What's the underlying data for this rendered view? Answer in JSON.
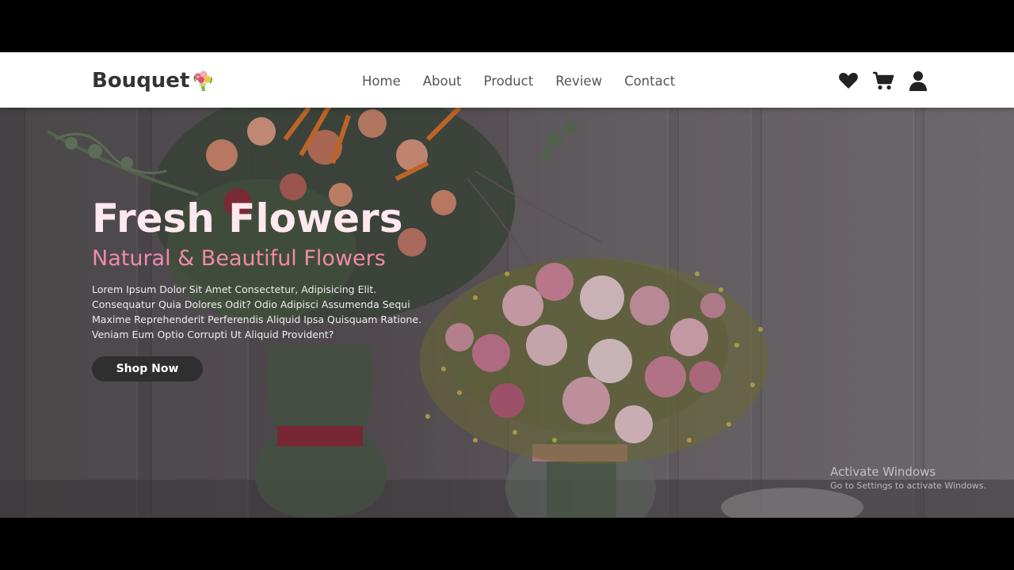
{
  "navbar": {
    "logo_text": "Bouquet",
    "links": [
      "Home",
      "About",
      "Product",
      "Review",
      "Contact"
    ],
    "icons": [
      "heart-icon",
      "cart-icon",
      "user-icon"
    ]
  },
  "hero": {
    "title": "Fresh Flowers",
    "subtitle": "Natural & Beautiful Flowers",
    "text": "Lorem Ipsum Dolor Sit Amet Consectetur, Adipisicing Elit. Consequatur Quia Dolores Odit? Odio Adipisci Assumenda Sequi Maxime Reprehenderit Perferendis Aliquid Ipsa Quisquam Ratione. Veniam Eum Optio Corrupti Ut Aliquid Provident?",
    "button_label": "Shop Now"
  },
  "watermark": {
    "title": "Activate Windows",
    "subtitle": "Go to Settings to activate Windows."
  },
  "colors": {
    "title": "#ffe8ef",
    "subtitle": "#f08aa8",
    "button": "#2f2f2f",
    "navbar": "#ffffff"
  }
}
